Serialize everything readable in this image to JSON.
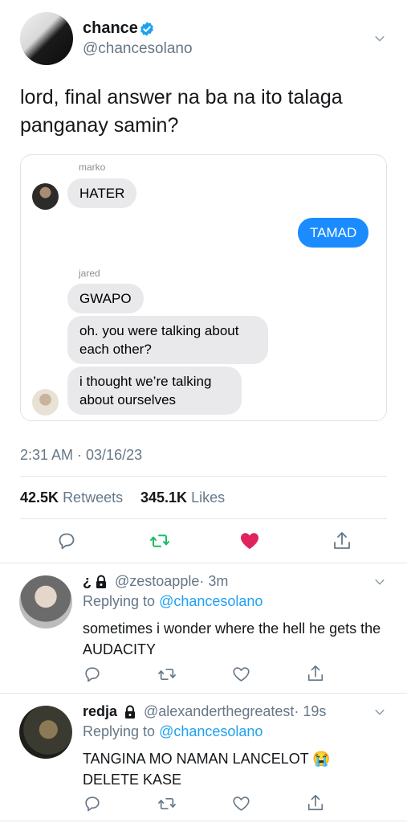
{
  "tweet": {
    "author_name": "chance",
    "author_handle": "@chancesolano",
    "text": "lord, final answer na ba na ito talaga panganay samin?",
    "timestamp": "2:31 AM · 03/16/23",
    "retweets_count": "42.5K",
    "retweets_label": "Retweets",
    "likes_count": "345.1K",
    "likes_label": "Likes"
  },
  "chat": {
    "sender1": "marko",
    "msg1": "HATER",
    "msg_out": "TAMAD",
    "sender2": "jared",
    "msg2": "GWAPO",
    "msg3": "oh. you were talking about each other?",
    "msg4": "i thought we’re talking about ourselves"
  },
  "replies": [
    {
      "name": "¿",
      "handle": "@zestoapple",
      "time": "· 3m",
      "replying_prefix": "Replying to",
      "replying_to": "@chancesolano",
      "text": "sometimes i wonder where the hell he gets the AUDACITY"
    },
    {
      "name": "redja",
      "handle": "@alexanderthegreatest",
      "time": "· 19s",
      "replying_prefix": "Replying to",
      "replying_to": "@chancesolano",
      "text": "TANGINA MO NAMAN LANCELOT 😭 DELETE KASE"
    }
  ],
  "colors": {
    "accent": "#1da1f2",
    "retweet_green": "#17bf63",
    "like_red": "#e0245e",
    "imessage_blue": "#1a8cff"
  },
  "icons": [
    "verified-badge-icon",
    "chevron-down-icon",
    "reply-icon",
    "retweet-icon",
    "like-icon",
    "share-icon",
    "lock-icon"
  ]
}
